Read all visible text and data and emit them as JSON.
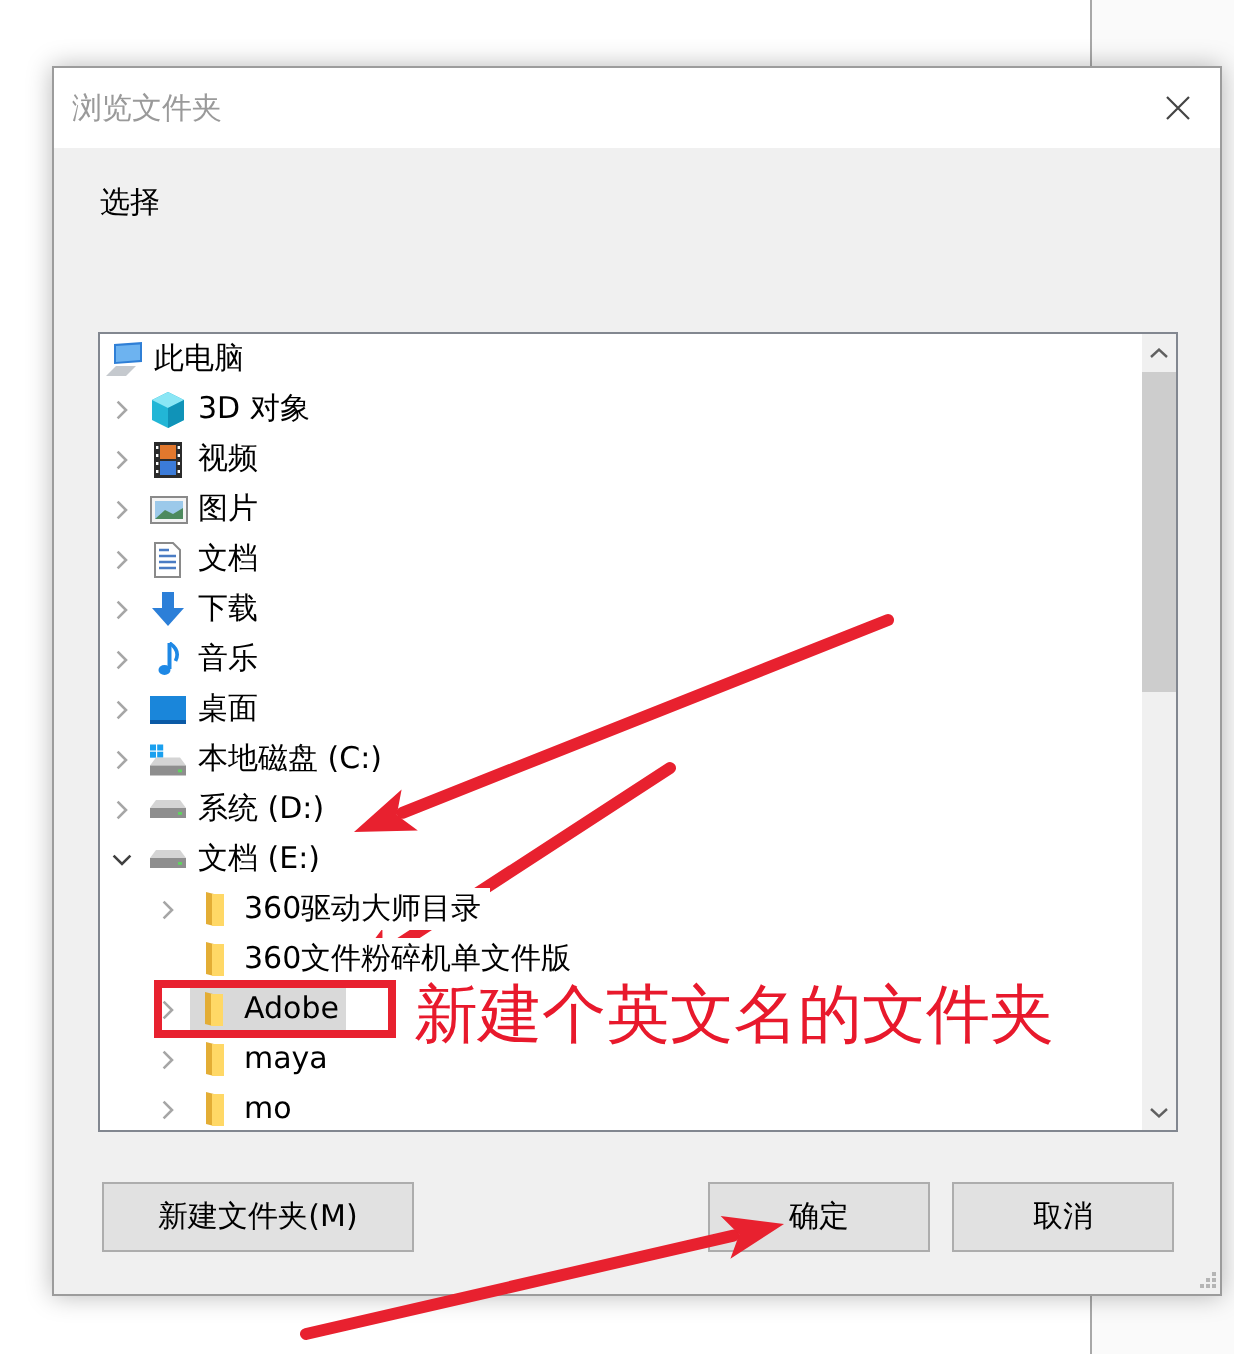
{
  "dialog": {
    "title": "浏览文件夹",
    "prompt": "选择"
  },
  "tree": {
    "items": [
      {
        "label": "此电脑",
        "kind": "computer",
        "selected": false,
        "marked": false,
        "children": [
          {
            "label": "3D 对象",
            "kind": "objects",
            "expandable": true,
            "expanded": false,
            "selected": false,
            "marked": false
          },
          {
            "label": "视频",
            "kind": "videos",
            "expandable": true,
            "expanded": false,
            "selected": false,
            "marked": false
          },
          {
            "label": "图片",
            "kind": "pictures",
            "expandable": true,
            "expanded": false,
            "selected": false,
            "marked": false
          },
          {
            "label": "文档",
            "kind": "documents",
            "expandable": true,
            "expanded": false,
            "selected": false,
            "marked": false
          },
          {
            "label": "下载",
            "kind": "downloads",
            "expandable": true,
            "expanded": false,
            "selected": false,
            "marked": false
          },
          {
            "label": "音乐",
            "kind": "music",
            "expandable": true,
            "expanded": false,
            "selected": false,
            "marked": false
          },
          {
            "label": "桌面",
            "kind": "desktop",
            "expandable": true,
            "expanded": false,
            "selected": false,
            "marked": false
          },
          {
            "label": "本地磁盘 (C:)",
            "kind": "sysdrive",
            "expandable": true,
            "expanded": false,
            "selected": false,
            "marked": false
          },
          {
            "label": "系统 (D:)",
            "kind": "drive",
            "expandable": true,
            "expanded": false,
            "selected": false,
            "marked": false
          },
          {
            "label": "文档 (E:)",
            "kind": "drive",
            "expandable": true,
            "expanded": true,
            "selected": false,
            "marked": false,
            "children": [
              {
                "label": "360驱动大师目录",
                "kind": "folder",
                "expandable": true,
                "expanded": false,
                "selected": false,
                "marked": false
              },
              {
                "label": "360文件粉碎机单文件版",
                "kind": "folder",
                "expandable": false,
                "selected": false,
                "marked": false
              },
              {
                "label": "Adobe",
                "kind": "folder",
                "expandable": true,
                "expanded": false,
                "selected": true,
                "marked": true
              },
              {
                "label": "maya",
                "kind": "folder",
                "expandable": true,
                "expanded": false,
                "selected": false,
                "marked": false
              },
              {
                "label": "mo",
                "kind": "folder",
                "expandable": true,
                "expanded": false,
                "selected": false,
                "marked": false
              }
            ]
          }
        ]
      }
    ]
  },
  "new_folder_button": "新建文件夹(M)",
  "buttons": [
    "确定",
    "取消"
  ],
  "annotation": {
    "note": "新建个英文名的文件夹"
  }
}
